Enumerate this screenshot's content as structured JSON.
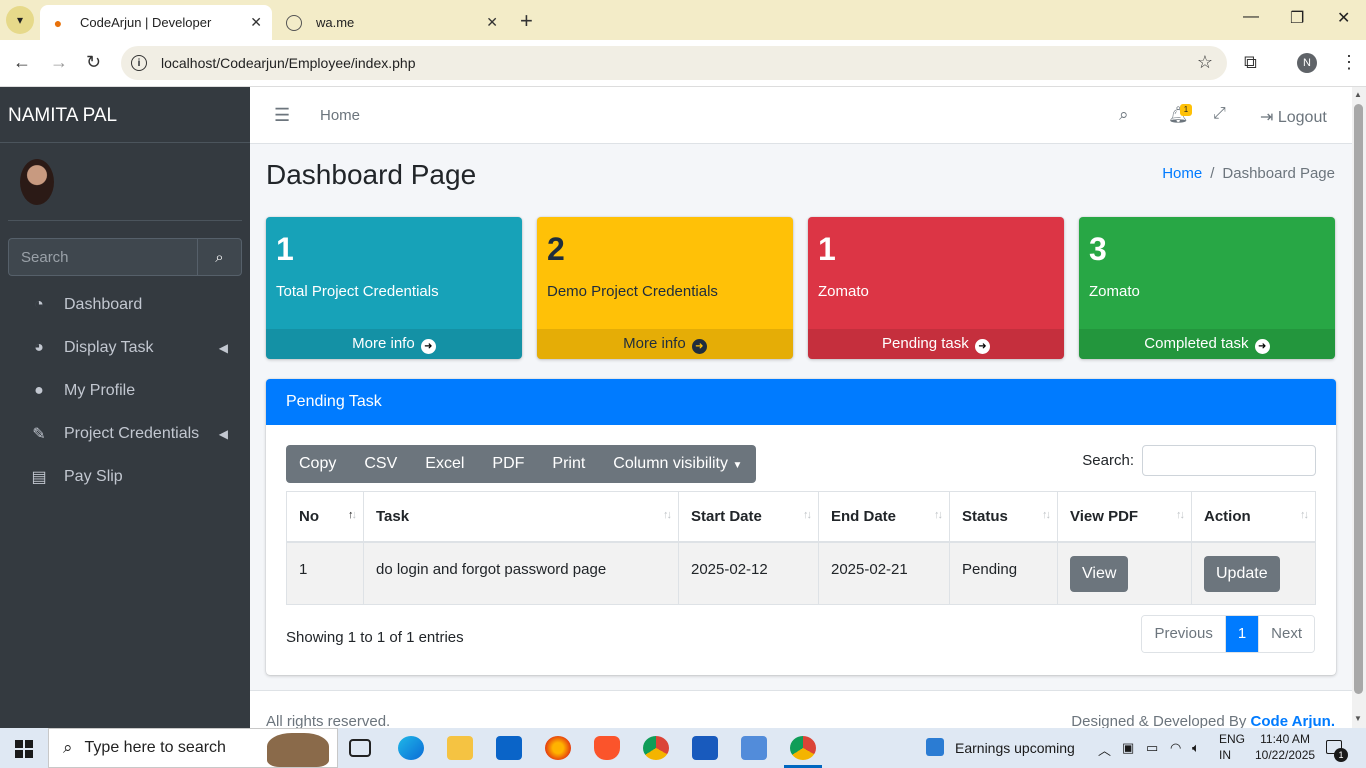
{
  "browser": {
    "tabs": [
      {
        "title": "CodeArjun | Developer",
        "active": true
      },
      {
        "title": "wa.me",
        "active": false
      }
    ],
    "url": "localhost/Codearjun/Employee/index.php",
    "profile_initial": "N"
  },
  "sidebar": {
    "brand": "NAMITA PAL",
    "search_placeholder": "Search",
    "items": [
      {
        "label": "Dashboard",
        "icon": "tachometer-icon"
      },
      {
        "label": "Display Task",
        "icon": "pie-chart-icon",
        "has_children": true
      },
      {
        "label": "My Profile",
        "icon": "user-icon"
      },
      {
        "label": "Project Credentials",
        "icon": "edit-icon",
        "has_children": true
      },
      {
        "label": "Pay Slip",
        "icon": "receipt-icon"
      }
    ]
  },
  "topnav": {
    "home": "Home",
    "notification_count": "1",
    "logout": "Logout"
  },
  "page": {
    "title": "Dashboard Page",
    "breadcrumb": {
      "home": "Home",
      "current": "Dashboard Page"
    }
  },
  "stat_boxes": [
    {
      "number": "1",
      "label": "Total Project Credentials",
      "footer": "More info",
      "color": "#17a2b8"
    },
    {
      "number": "2",
      "label": "Demo Project Credentials",
      "footer": "More info",
      "color": "#ffc107"
    },
    {
      "number": "1",
      "label": "Zomato",
      "footer": "Pending task",
      "color": "#dc3545"
    },
    {
      "number": "3",
      "label": "Zomato",
      "footer": "Completed task",
      "color": "#28a745"
    }
  ],
  "pending_card": {
    "title": "Pending Task",
    "export_buttons": [
      "Copy",
      "CSV",
      "Excel",
      "PDF",
      "Print",
      "Column visibility"
    ],
    "search_label": "Search:",
    "columns": [
      "No",
      "Task",
      "Start Date",
      "End Date",
      "Status",
      "View PDF",
      "Action"
    ],
    "rows": [
      {
        "no": "1",
        "task": "do login and forgot password page",
        "start": "2025-02-12",
        "end": "2025-02-21",
        "status": "Pending",
        "view": "View",
        "action": "Update"
      }
    ],
    "info": "Showing 1 to 1 of 1 entries",
    "pagination": {
      "previous": "Previous",
      "current": "1",
      "next": "Next"
    }
  },
  "footer": {
    "left": "All rights reserved.",
    "right_prefix": "Designed & Developed By",
    "right_brand": "Code Arjun."
  },
  "taskbar": {
    "search_placeholder": "Type here to search",
    "weather": "Earnings upcoming",
    "lang_1": "ENG",
    "lang_2": "IN",
    "time": "11:40 AM",
    "date": "10/22/2025",
    "notification_count": "1"
  },
  "colors": {
    "primary": "#007bff",
    "sidebar": "#343a40",
    "secondary": "#6c757d"
  }
}
